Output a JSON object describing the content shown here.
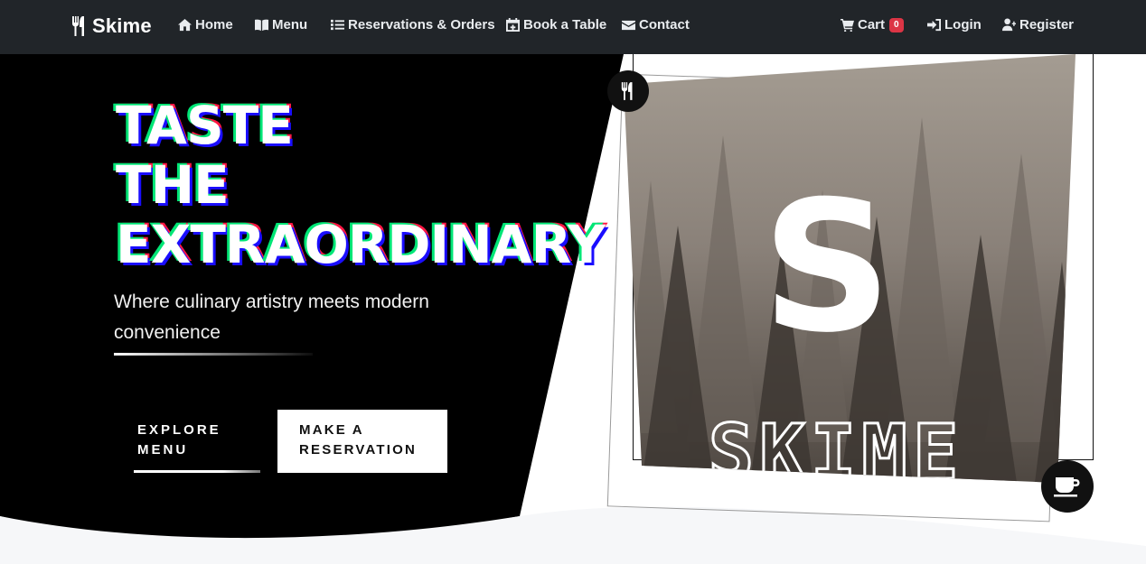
{
  "brand": {
    "name": "Skime"
  },
  "nav": {
    "items": [
      {
        "label": "Home",
        "icon": "home-icon"
      },
      {
        "label": "Menu",
        "icon": "book-open-icon"
      },
      {
        "label": "Reservations & Orders",
        "icon": "list-icon"
      },
      {
        "label": "Book a Table",
        "icon": "calendar-icon"
      },
      {
        "label": "Contact",
        "icon": "envelope-icon"
      }
    ],
    "cart": {
      "label": "Cart",
      "count": "0",
      "icon": "cart-icon"
    },
    "login": {
      "label": "Login",
      "icon": "sign-in-icon"
    },
    "register": {
      "label": "Register",
      "icon": "user-plus-icon"
    }
  },
  "hero": {
    "headline": [
      "TASTE",
      "THE",
      "EXTRAORDINARY"
    ],
    "subtitle": "Where culinary artistry meets modern convenience",
    "buttons": {
      "explore": "EXPLORE MENU",
      "reserve": "MAKE A RESERVATION"
    },
    "image": {
      "logo_letter": "S",
      "logo_word": "SKIME"
    }
  },
  "colors": {
    "navbar": "#212529",
    "hero_bg": "#000000",
    "badge": "#dc3545",
    "accent_green": "#00e676",
    "accent_blue": "#1a0dff",
    "accent_red": "#ff1744"
  }
}
